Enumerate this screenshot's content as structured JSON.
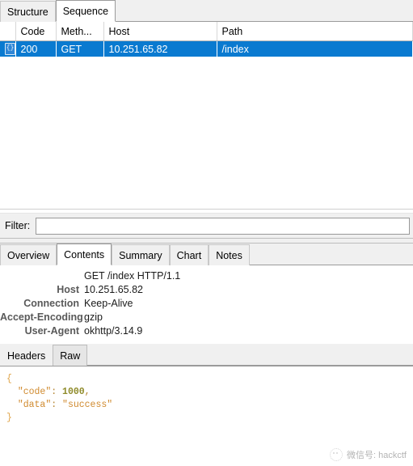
{
  "top_tabs": [
    {
      "label": "Structure",
      "active": false
    },
    {
      "label": "Sequence",
      "active": true
    }
  ],
  "request_table": {
    "columns": [
      "",
      "Code",
      "Meth...",
      "Host",
      "Path"
    ],
    "rows": [
      {
        "icon": "json-document-icon",
        "code": "200",
        "method": "GET",
        "host": "10.251.65.82",
        "path": "/index",
        "selected": true
      }
    ],
    "selection_color": "#0a7ad0"
  },
  "filter": {
    "label": "Filter:",
    "value": "",
    "placeholder": ""
  },
  "detail_tabs": [
    {
      "label": "Overview",
      "active": false
    },
    {
      "label": "Contents",
      "active": true
    },
    {
      "label": "Summary",
      "active": false
    },
    {
      "label": "Chart",
      "active": false
    },
    {
      "label": "Notes",
      "active": false
    }
  ],
  "headers_panel": {
    "request_line": "GET /index HTTP/1.1",
    "headers": [
      {
        "name": "Host",
        "value": "10.251.65.82"
      },
      {
        "name": "Connection",
        "value": "Keep-Alive"
      },
      {
        "name": "Accept-Encoding",
        "value": "gzip"
      },
      {
        "name": "User-Agent",
        "value": "okhttp/3.14.9"
      }
    ]
  },
  "body_tabs": [
    {
      "label": "Headers",
      "active": false
    },
    {
      "label": "Raw",
      "active": true
    }
  ],
  "raw_body": {
    "open_brace": "{",
    "close_brace": "}",
    "entries": [
      {
        "key": "\"code\"",
        "sep": ": ",
        "value": "1000",
        "type": "number",
        "trailing": ","
      },
      {
        "key": "\"data\"",
        "sep": ": ",
        "value": "\"success\"",
        "type": "string",
        "trailing": ""
      }
    ]
  },
  "watermark": {
    "icon": "wechat-icon",
    "text": "微信号: hackctf"
  }
}
